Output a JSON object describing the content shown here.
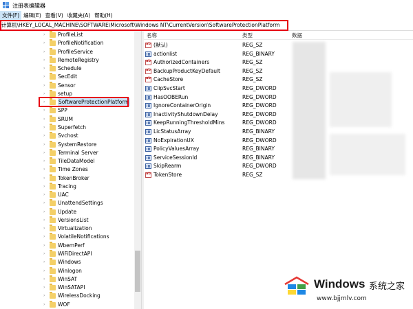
{
  "window": {
    "title": "注册表编辑器"
  },
  "menu": [
    "文件(F)",
    "编辑(E)",
    "查看(V)",
    "收藏夹(A)",
    "帮助(H)"
  ],
  "address": "计算机\\HKEY_LOCAL_MACHINE\\SOFTWARE\\Microsoft\\Windows NT\\CurrentVersion\\SoftwareProtectionPlatform",
  "tree": {
    "selected": "SoftwareProtectionPlatform",
    "items": [
      "ProfileList",
      "ProfileNotification",
      "ProfileService",
      "RemoteRegistry",
      "Schedule",
      "SecEdit",
      "Sensor",
      "setup",
      "SoftwareProtectionPlatform",
      "SPP",
      "SRUM",
      "Superfetch",
      "Svchost",
      "SystemRestore",
      "Terminal Server",
      "TileDataModel",
      "Time Zones",
      "TokenBroker",
      "Tracing",
      "UAC",
      "UnattendSettings",
      "Update",
      "VersionsList",
      "Virtualization",
      "VolatileNotifications",
      "WbemPerf",
      "WiFiDirectAPI",
      "Windows",
      "Winlogon",
      "WinSAT",
      "WinSATAPI",
      "WirelessDocking",
      "WOF"
    ]
  },
  "columns": {
    "name": "名称",
    "type": "类型",
    "data": "数据"
  },
  "values": [
    {
      "name": "(默认)",
      "type": "REG_SZ",
      "icon": "string-value-icon"
    },
    {
      "name": "actionlist",
      "type": "REG_BINARY",
      "icon": "binary-value-icon"
    },
    {
      "name": "AuthorizedContainers",
      "type": "REG_SZ",
      "icon": "string-value-icon"
    },
    {
      "name": "BackupProductKeyDefault",
      "type": "REG_SZ",
      "icon": "string-value-icon"
    },
    {
      "name": "CacheStore",
      "type": "REG_SZ",
      "icon": "string-value-icon"
    },
    {
      "name": "ClipSvcStart",
      "type": "REG_DWORD",
      "icon": "binary-value-icon"
    },
    {
      "name": "HasOOBERun",
      "type": "REG_DWORD",
      "icon": "binary-value-icon"
    },
    {
      "name": "IgnoreContainerOrigin",
      "type": "REG_DWORD",
      "icon": "binary-value-icon"
    },
    {
      "name": "InactivityShutdownDelay",
      "type": "REG_DWORD",
      "icon": "binary-value-icon"
    },
    {
      "name": "KeepRunningThresholdMins",
      "type": "REG_DWORD",
      "icon": "binary-value-icon"
    },
    {
      "name": "LicStatusArray",
      "type": "REG_BINARY",
      "icon": "binary-value-icon"
    },
    {
      "name": "NoExpirationUX",
      "type": "REG_DWORD",
      "icon": "binary-value-icon"
    },
    {
      "name": "PolicyValuesArray",
      "type": "REG_BINARY",
      "icon": "binary-value-icon"
    },
    {
      "name": "ServiceSessionId",
      "type": "REG_BINARY",
      "icon": "binary-value-icon"
    },
    {
      "name": "SkipRearm",
      "type": "REG_DWORD",
      "icon": "binary-value-icon"
    },
    {
      "name": "TokenStore",
      "type": "REG_SZ",
      "icon": "string-value-icon"
    }
  ],
  "watermark": {
    "brand": "Windows",
    "cn": "系统之家",
    "url": "www.bjjmlv.com"
  },
  "colors": {
    "highlight_border": "#e60012",
    "selection": "#cce4f7",
    "folder": "#f4d068"
  }
}
